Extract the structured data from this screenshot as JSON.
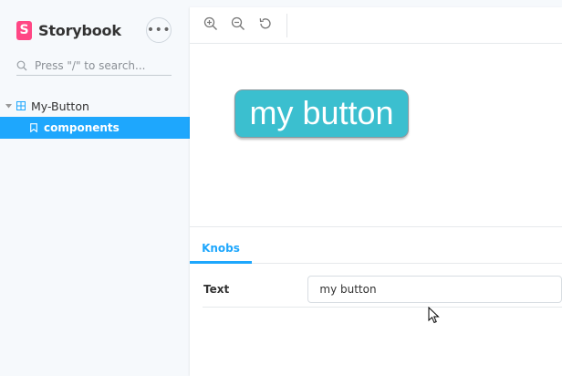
{
  "sidebar": {
    "brand_name": "Storybook",
    "brand_logo_letter": "S",
    "menu_label": "•••",
    "search_placeholder": "Press \"/\" to search...",
    "tree": {
      "root_label": "My-Button",
      "selected_item_label": "components"
    }
  },
  "toolbar": {
    "icons": [
      "zoom-in-icon",
      "zoom-out-icon",
      "reset-zoom-icon"
    ]
  },
  "preview": {
    "button_label": "my button"
  },
  "addons": {
    "active_tab": "Knobs",
    "knobs": [
      {
        "label": "Text",
        "value": "my button"
      }
    ]
  },
  "colors": {
    "accent": "#1ea7fd",
    "brand": "#ff4785",
    "demo_button": "#3bbfcf"
  }
}
